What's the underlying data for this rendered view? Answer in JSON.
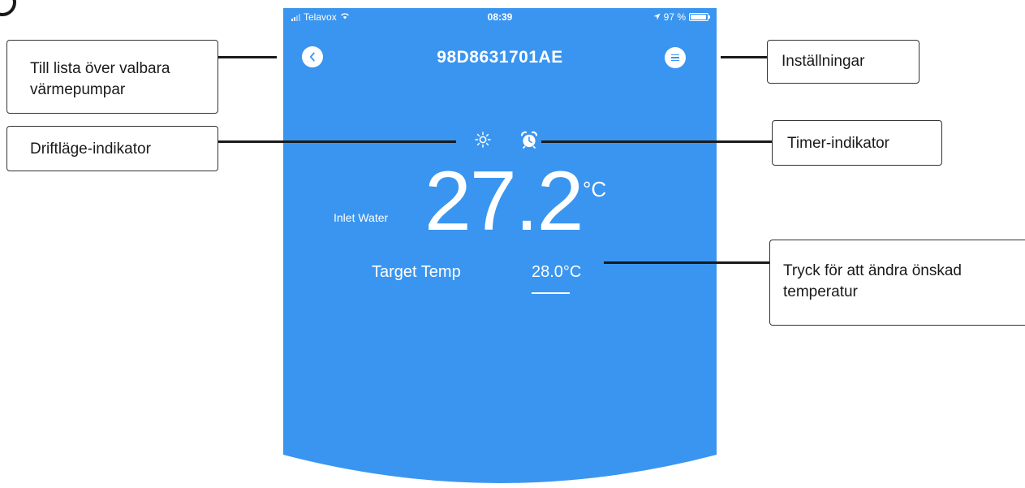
{
  "status_bar": {
    "carrier": "Telavox",
    "time": "08:39",
    "battery_percent": "97 %",
    "battery_level": 0.97
  },
  "nav": {
    "title": "98D8631701AE",
    "back_icon": "chevron-left-icon",
    "menu_icon": "menu-icon"
  },
  "indicators": {
    "mode_icon": "sun-icon",
    "timer_icon": "alarm-clock-icon"
  },
  "reading": {
    "label": "Inlet Water",
    "value": "27.2",
    "unit": "°C"
  },
  "target": {
    "label": "Target Temp",
    "value": "28.0°C"
  },
  "callouts": {
    "back": "Till lista över valbara värmepumpar",
    "settings": "Inställningar",
    "mode": "Driftläge-indikator",
    "timer": "Timer-indikator",
    "target": "Tryck för att ändra önskad temperatur"
  },
  "colors": {
    "app_background": "#3a95f0",
    "foreground": "#ffffff"
  }
}
